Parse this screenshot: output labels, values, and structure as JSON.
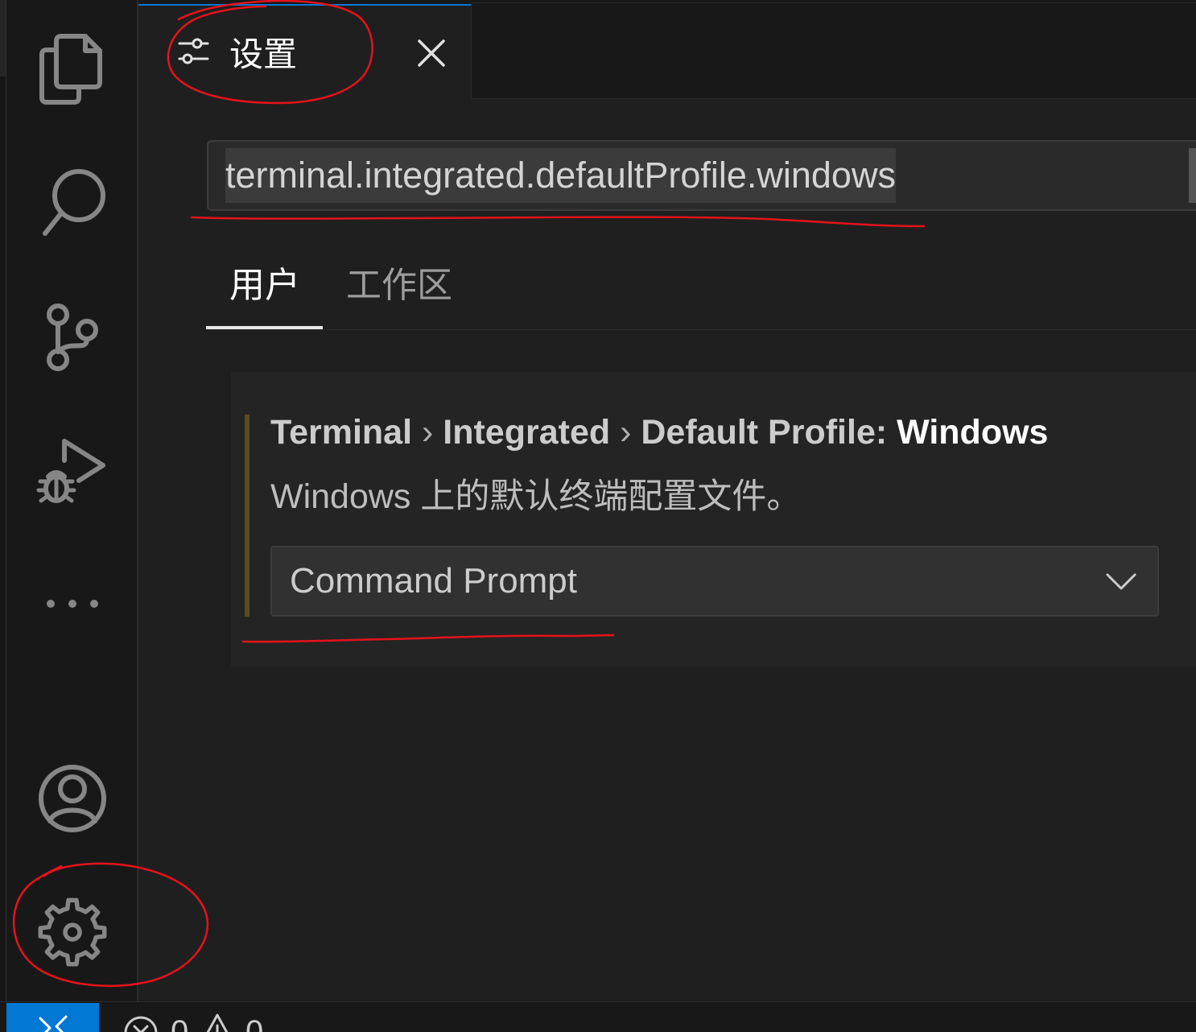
{
  "colors": {
    "accent": "#0078d4",
    "editor_background": "#1f1f1f",
    "chrome_background": "#181818",
    "icon_foreground": "#868686",
    "annotation": "#e5121c",
    "focus_indicator": "#5c4b22"
  },
  "activity_bar": {
    "items": [
      {
        "icon": "files-icon",
        "active": false
      },
      {
        "icon": "search-icon",
        "active": false
      },
      {
        "icon": "source-control-icon",
        "active": false
      },
      {
        "icon": "run-debug-icon",
        "active": false
      },
      {
        "icon": "ellipsis-icon",
        "active": false
      }
    ],
    "bottom_items": [
      {
        "icon": "account-icon"
      },
      {
        "icon": "gear-icon"
      }
    ]
  },
  "editor_tabs": [
    {
      "label": "设置",
      "icon": "settings-sliders-icon",
      "active": true,
      "close_icon": "close-icon"
    }
  ],
  "settings_editor": {
    "search": {
      "value": "terminal.integrated.defaultProfile.windows",
      "text_selected": true
    },
    "scope_tabs": [
      {
        "label": "用户",
        "active": true
      },
      {
        "label": "工作区",
        "active": false
      }
    ],
    "items": [
      {
        "category": [
          "Terminal",
          "Integrated",
          "Default Profile:"
        ],
        "separator": "›",
        "label": "Windows",
        "description": "Windows 上的默认终端配置文件。",
        "value": "Command Prompt",
        "control_icon": "chevron-down-icon"
      }
    ]
  },
  "status_bar": {
    "remote_icon": "remote-icon",
    "problems": [
      {
        "icon": "error-icon",
        "count": "0"
      },
      {
        "icon": "warning-icon",
        "count": "0"
      }
    ]
  }
}
